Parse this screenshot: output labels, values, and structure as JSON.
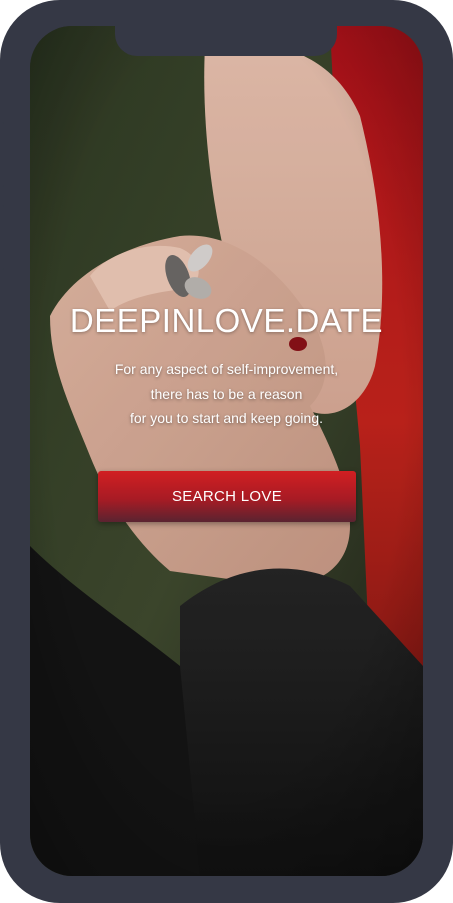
{
  "app": {
    "brand_title": "DEEPINLOVE.DATE",
    "tagline_lines": [
      "For any aspect of self-improvement,",
      "there has to be a reason",
      "for you to start and keep going."
    ],
    "cta_label": "SEARCH LOVE"
  },
  "colors": {
    "device_frame": "#353845",
    "cta_red": "#d11f22",
    "cta_dark": "#5a2330",
    "text": "#ffffff"
  },
  "background_image": "hands-holding-with-ring-photo"
}
